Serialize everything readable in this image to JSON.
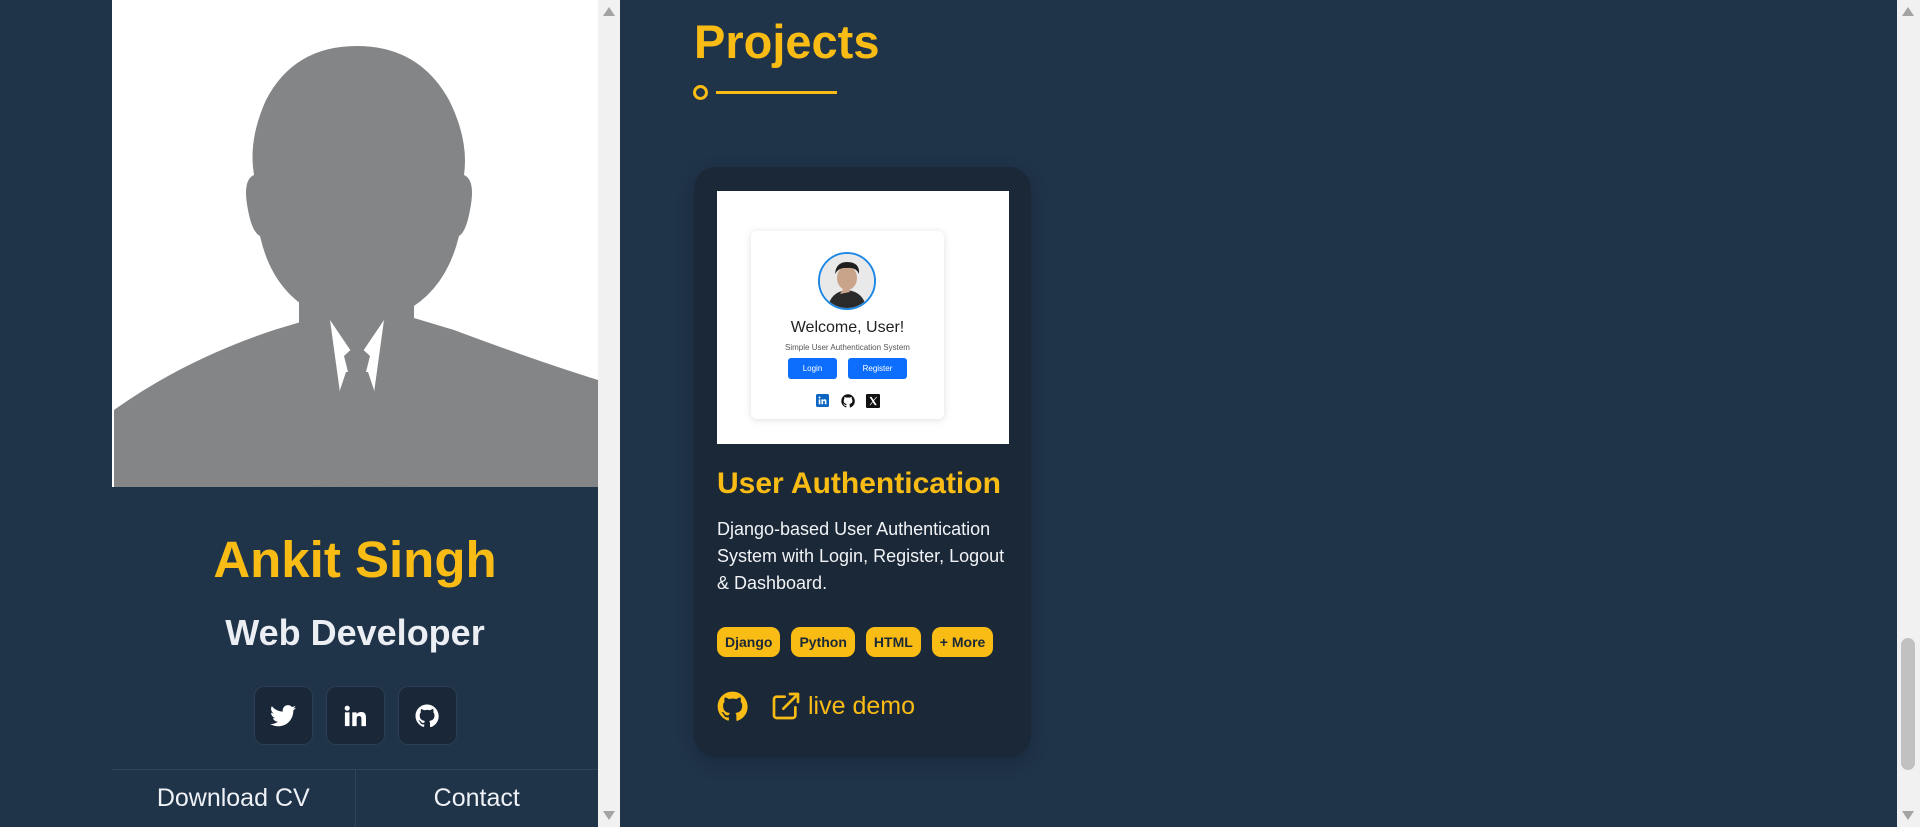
{
  "profile": {
    "name": "Ankit Singh",
    "role": "Web Developer",
    "social": [
      {
        "icon": "twitter-icon"
      },
      {
        "icon": "linkedin-icon"
      },
      {
        "icon": "github-icon"
      }
    ],
    "download_cv_label": "Download CV",
    "contact_label": "Contact"
  },
  "projects_section": {
    "title": "Projects",
    "accent_color": "#f9bc15",
    "background_color": "#1f3349",
    "projects": [
      {
        "title": "User Authentication",
        "description": "Django-based User Authentication System with Login, Register, Logout & Dashboard.",
        "tags": [
          "Django",
          "Python",
          "HTML",
          "+ More"
        ],
        "live_demo_label": "live demo",
        "thumbnail": {
          "heading": "Welcome, User!",
          "subheading": "Simple User Authentication System",
          "login_label": "Login",
          "register_label": "Register",
          "icons": [
            "linkedin-icon",
            "github-icon",
            "x-icon"
          ]
        }
      }
    ]
  }
}
